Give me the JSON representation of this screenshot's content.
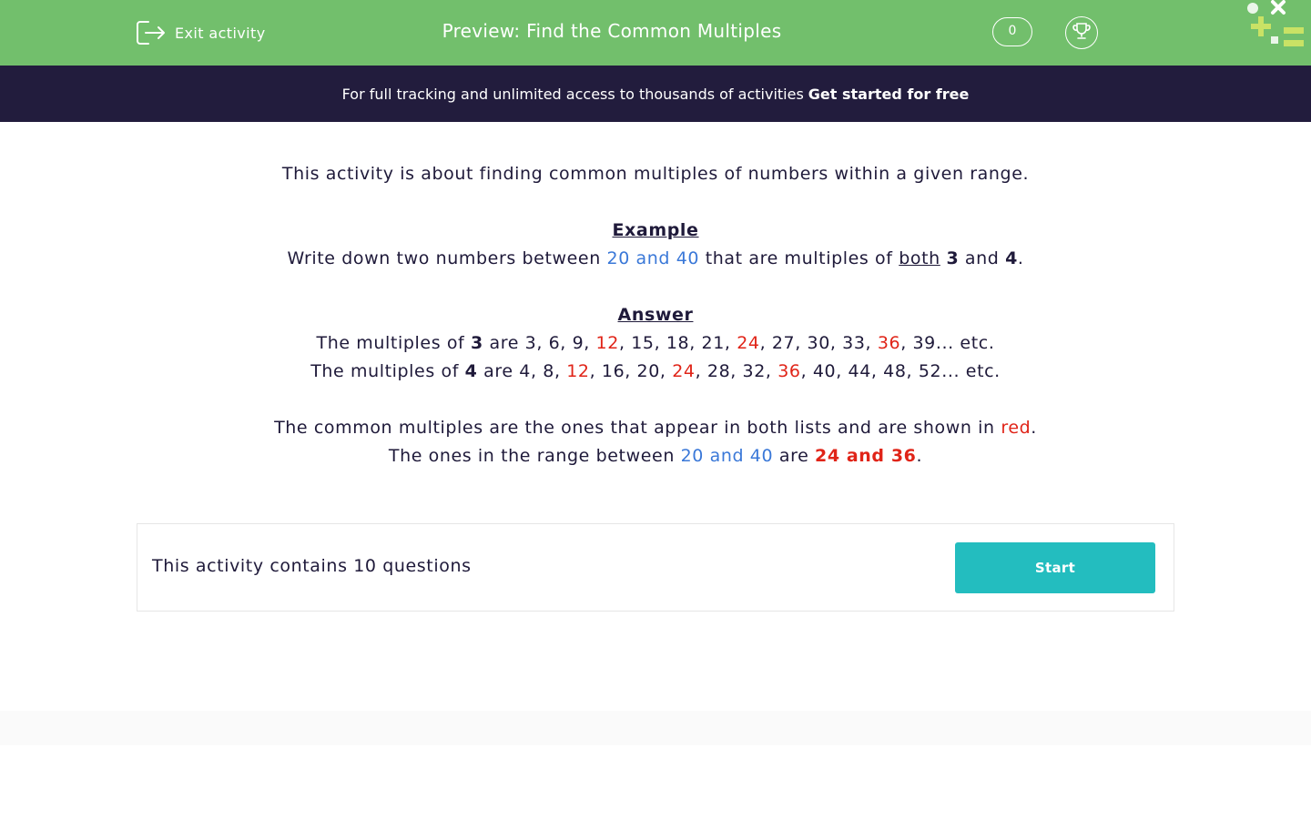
{
  "header": {
    "exit_label": "Exit activity",
    "title": "Preview: Find the Common Multiples",
    "score": "0",
    "bg_color": "#72bf6c"
  },
  "banner": {
    "text": "For full tracking and unlimited access to thousands of activities",
    "cta": "Get started for free",
    "bg_color": "#221c3d"
  },
  "intro": "This activity is about finding common multiples of numbers within a given range.",
  "example": {
    "heading": "Example",
    "q_part1": "Write down two numbers between",
    "q_range": "20 and 40",
    "q_part2": "that are multiples of",
    "q_both": "both",
    "q_num1": "3",
    "q_and": "and",
    "q_num2": "4",
    "q_end": "."
  },
  "answer": {
    "heading": "Answer",
    "line1": {
      "prefix": "The multiples of",
      "num": "3",
      "are": "are 3, 6, 9,",
      "r1": "12",
      "m1": ", 15, 18, 21,",
      "r2": "24",
      "m2": ", 27, 30, 33,",
      "r3": "36",
      "end": ", 39... etc."
    },
    "line2": {
      "prefix": "The multiples of",
      "num": "4",
      "are": "are 4, 8,",
      "r1": "12",
      "m1": ", 16, 20,",
      "r2": "24",
      "m2": ", 28, 32,",
      "r3": "36",
      "end": ", 40, 44, 48, 52... etc."
    },
    "common_text": "The common multiples are the ones that appear in both lists and are shown in",
    "common_red": "red",
    "common_end": ".",
    "range_prefix": "The ones in the range between",
    "range_blue": "20 and 40",
    "range_are": "are",
    "range_answer": "24 and 36",
    "range_end": "."
  },
  "panel": {
    "text": "This activity contains 10 questions",
    "start_label": "Start",
    "button_color": "#23bdbf"
  },
  "colors": {
    "highlight_blue": "#3a78d8",
    "highlight_red": "#e02418",
    "text": "#1f1a3a"
  }
}
